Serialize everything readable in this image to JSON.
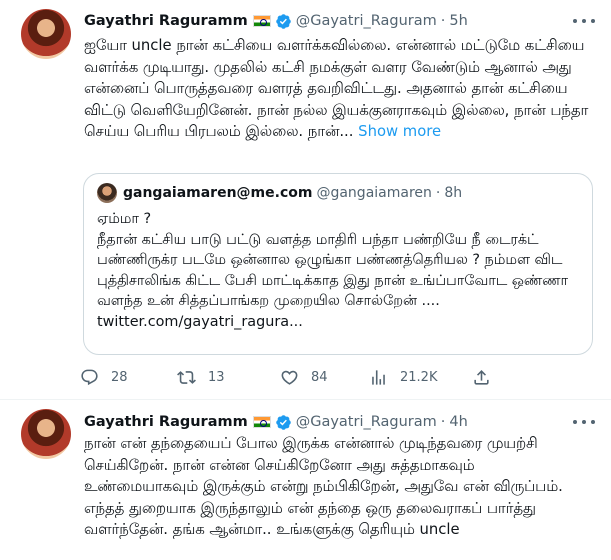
{
  "tweets": [
    {
      "author": {
        "name": "Gayathri Raguramm",
        "handle": "@Gayatri_Raguram",
        "time": "5h"
      },
      "text": "ஐயோ uncle நான் கட்சியை வளர்க்கவில்லை. என்னால் மட்டுமே கட்சியை வளர்க்க முடியாது. முதலில் கட்சி நமக்குள் வளர வேண்டும் ஆனால் அது என்னைப் பொருத்தவரை வளரத் தவறிவிட்டது. அதனால் தான் கட்சியை விட்டு வெளியேறினேன். நான் நல்ல இயக்குனராகவும் இல்லை, நான் பந்தா செய்ய பெரிய பிரபலம் இல்லை. நான்...",
      "show_more": "Show more",
      "quote": {
        "name": "gangaiamaren@me.com",
        "handle": "@gangaiamaren",
        "time": "8h",
        "text": "ஏம்மா ?\nநீதான் கட்சிய பாடு பட்டு வளத்த மாதிரி பந்தா பண்றியே நீ டைரக்ட் பண்ணிருக்ர படமே ஒன்னால ஒழுங்கா பண்ணத்தெரியல ? நம்மள விட புத்திசாலிங்க கிட்ட பேசி மாட்டிக்காத இது நான் உங்ப்பாவோட ஒண்ணா வளந்த உன் சித்தப்பாங்கற முறையில சொல்றேன் ....\ntwitter.com/gayatri_ragura..."
      },
      "actions": {
        "replies": "28",
        "retweets": "13",
        "likes": "84",
        "views": "21.2K"
      }
    },
    {
      "author": {
        "name": "Gayathri Raguramm",
        "handle": "@Gayatri_Raguram",
        "time": "4h"
      },
      "text": "நான் என் தந்தையைப் போல இருக்க என்னால் முடிந்தவரை முயற்சி செய்கிறேன். நான் என்ன செய்கிறேனோ அது சுத்தமாகவும் உண்மையாகவும் இருக்கும் என்று நம்பிகிறேன், அதுவே என் விருப்பம். எந்தத் துறையாக இருந்தாலும் என் தந்தை ஒரு தலைவராகப் பார்த்து வளர்ந்தேன். தங்க ஆன்மா.. உங்களுக்கு தெரியும் uncle"
    }
  ],
  "icons": {
    "verified": "verified-badge-icon",
    "flag": "india-flag-icon",
    "more": "more-icon",
    "reply": "reply-icon",
    "retweet": "retweet-icon",
    "like": "heart-icon",
    "views": "views-icon",
    "share": "share-icon"
  },
  "colors": {
    "accent": "#1d9bf0",
    "secondary_text": "#536471",
    "border": "#cfd9de"
  }
}
